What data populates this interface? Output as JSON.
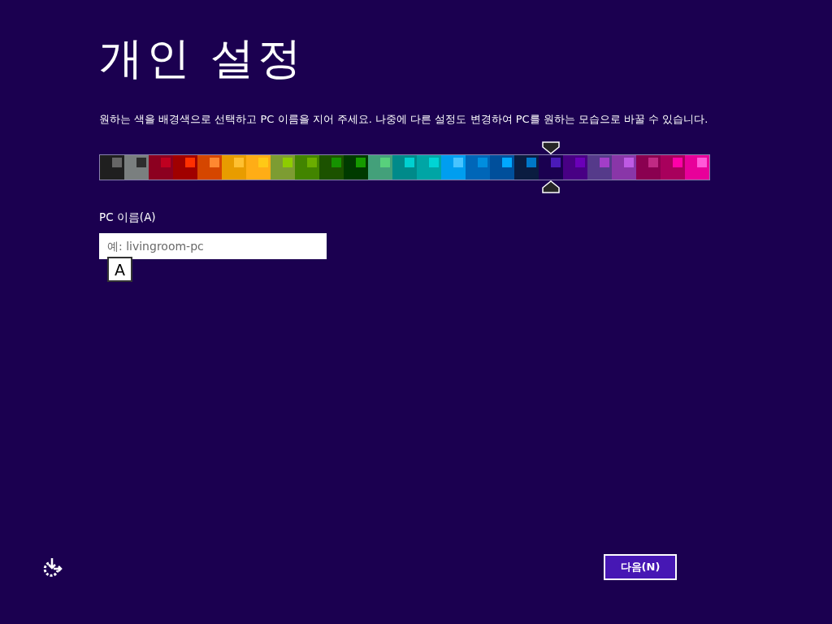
{
  "title": "개인 설정",
  "description": "원하는 색을 배경색으로 선택하고 PC 이름을 지어 주세요. 나중에 다른 설정도 변경하여 PC를 원하는 모습으로 바꿀 수 있습니다.",
  "swatches": [
    {
      "color": "#1f1f1f",
      "accent": {
        "color": "#666666"
      },
      "selected": false
    },
    {
      "color": "#7a7f7f",
      "accent": {
        "color": "#2d2d2d"
      },
      "selected": false
    },
    {
      "color": "#8c0020",
      "accent": {
        "color": "#bf0020"
      },
      "selected": false
    },
    {
      "color": "#a00000",
      "accent": {
        "color": "#ff3000"
      },
      "selected": false
    },
    {
      "color": "#d54600",
      "accent": {
        "color": "#ff8830"
      },
      "selected": false
    },
    {
      "color": "#e89c00",
      "accent": {
        "color": "#ffc030"
      },
      "selected": false
    },
    {
      "color": "#ffad16",
      "accent": {
        "color": "#ffc916"
      },
      "selected": false
    },
    {
      "color": "#7d9c32",
      "accent": {
        "color": "#8ecc00"
      },
      "selected": false
    },
    {
      "color": "#428400",
      "accent": {
        "color": "#6aad00"
      },
      "selected": false
    },
    {
      "color": "#1c5200",
      "accent": {
        "color": "#169200"
      },
      "selected": false
    },
    {
      "color": "#003a00",
      "accent": {
        "color": "#169a00"
      },
      "selected": false
    },
    {
      "color": "#43a07a",
      "accent": {
        "color": "#58d07c"
      },
      "selected": false
    },
    {
      "color": "#008a8a",
      "accent": {
        "color": "#00d0d0"
      },
      "selected": false
    },
    {
      "color": "#00a5a5",
      "accent": {
        "color": "#00d4d4"
      },
      "selected": false
    },
    {
      "color": "#009ef0",
      "accent": {
        "color": "#48c4ff"
      },
      "selected": false
    },
    {
      "color": "#0066b8",
      "accent": {
        "color": "#008edf"
      },
      "selected": false
    },
    {
      "color": "#004f9b",
      "accent": {
        "color": "#00a8ff"
      },
      "selected": false
    },
    {
      "color": "#0a1c40",
      "accent": {
        "color": "#0078c8"
      },
      "selected": false
    },
    {
      "color": "#1a0050",
      "accent": {
        "color": "#4a1ab8"
      },
      "selected": true
    },
    {
      "color": "#480084",
      "accent": {
        "color": "#6a00b8"
      },
      "selected": false
    },
    {
      "color": "#553a8a",
      "accent": {
        "color": "#a23ec8"
      },
      "selected": false
    },
    {
      "color": "#8936a8",
      "accent": {
        "color": "#be5ae4"
      },
      "selected": false
    },
    {
      "color": "#8a0050",
      "accent": {
        "color": "#c02a84"
      },
      "selected": false
    },
    {
      "color": "#a8005c",
      "accent": {
        "color": "#ff00a8"
      },
      "selected": false
    },
    {
      "color": "#e8009a",
      "accent": {
        "color": "#ff5ad8"
      },
      "selected": false
    }
  ],
  "pc_name": {
    "label": "PC 이름(A)",
    "placeholder": "예: livingroom-pc",
    "ime_indicator": "A"
  },
  "next_button": "다음(N)"
}
